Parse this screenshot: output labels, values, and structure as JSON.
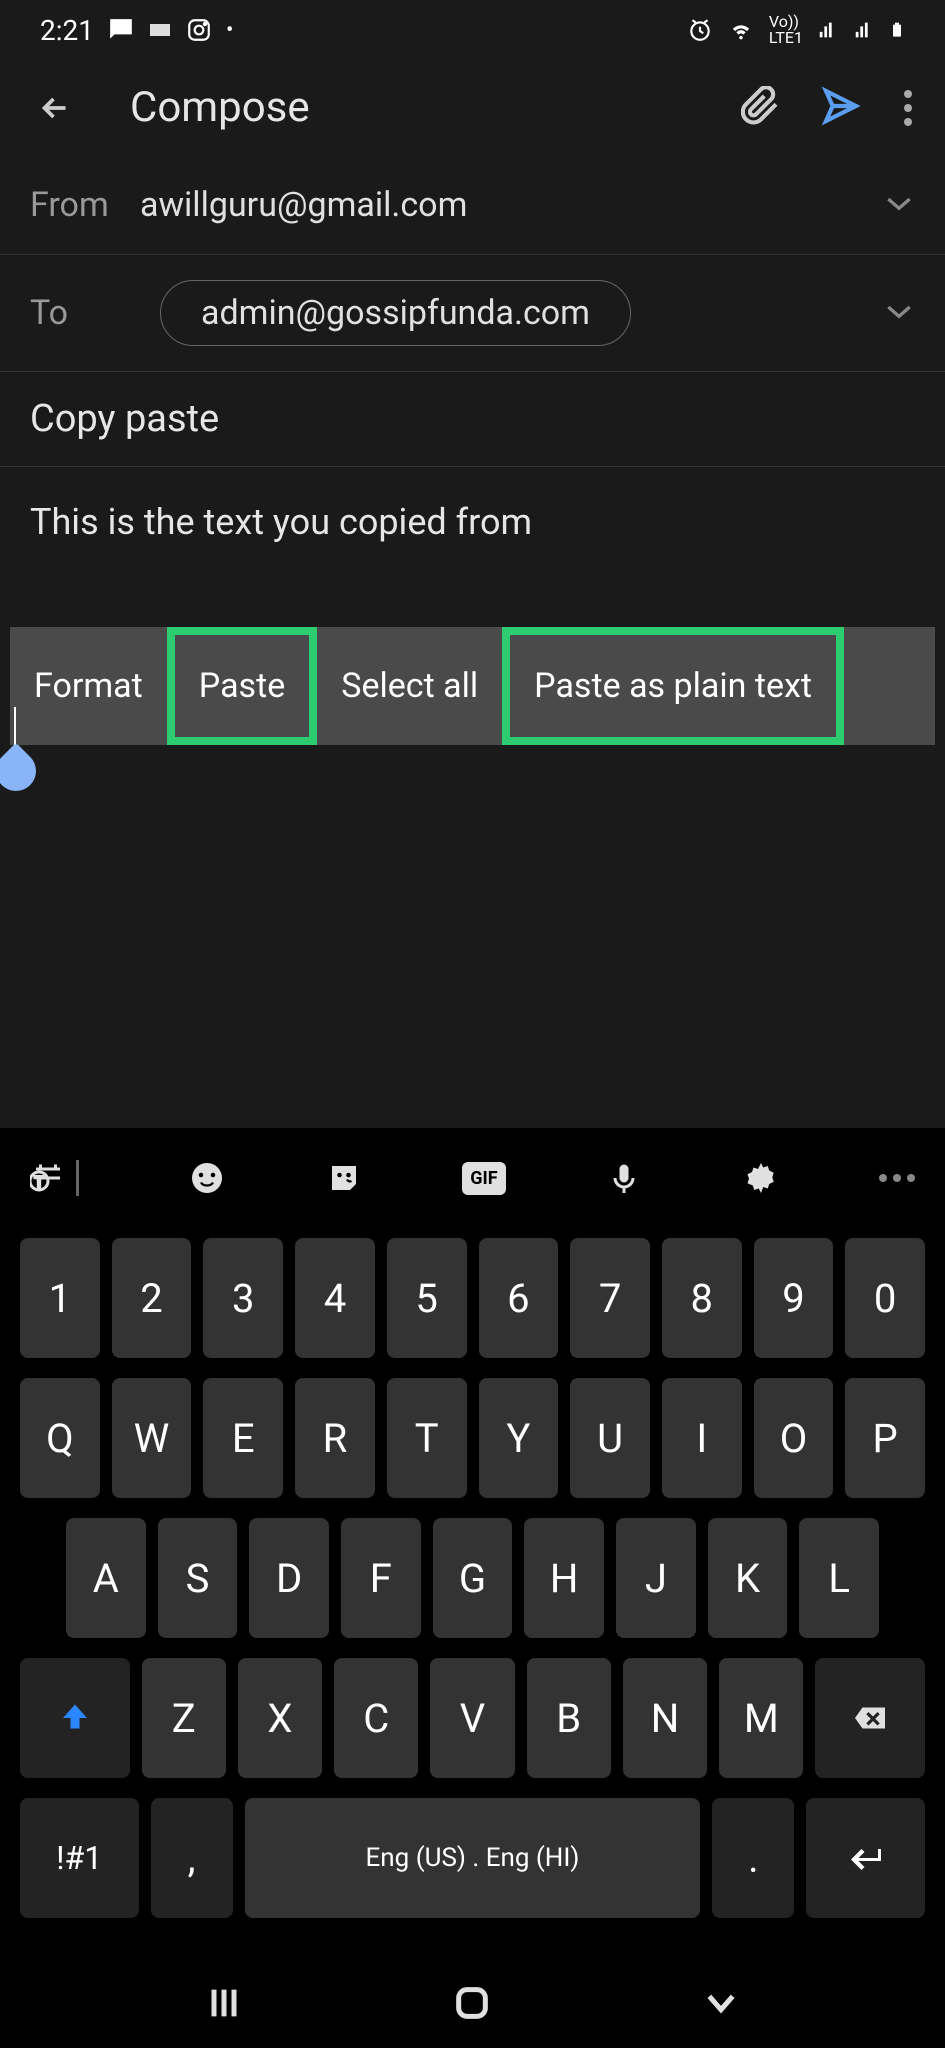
{
  "status": {
    "time": "2:21",
    "network": "LTE1",
    "volte": "Vo))"
  },
  "header": {
    "title": "Compose"
  },
  "compose": {
    "from_label": "From",
    "from_value": "awillguru@gmail.com",
    "to_label": "To",
    "to_chip": "admin@gossipfunda.com",
    "subject": "Copy paste",
    "body": "This is the text you copied from"
  },
  "context_menu": {
    "format": "Format",
    "paste": "Paste",
    "select_all": "Select all",
    "paste_plain": "Paste as plain text"
  },
  "keyboard": {
    "gif": "GIF",
    "row1": [
      "1",
      "2",
      "3",
      "4",
      "5",
      "6",
      "7",
      "8",
      "9",
      "0"
    ],
    "row2": [
      "Q",
      "W",
      "E",
      "R",
      "T",
      "Y",
      "U",
      "I",
      "O",
      "P"
    ],
    "row3": [
      "A",
      "S",
      "D",
      "F",
      "G",
      "H",
      "J",
      "K",
      "L"
    ],
    "row4": [
      "Z",
      "X",
      "C",
      "V",
      "B",
      "N",
      "M"
    ],
    "symkey": "!#1",
    "comma": ",",
    "space": "Eng (US) . Eng (HI)",
    "period": "."
  }
}
